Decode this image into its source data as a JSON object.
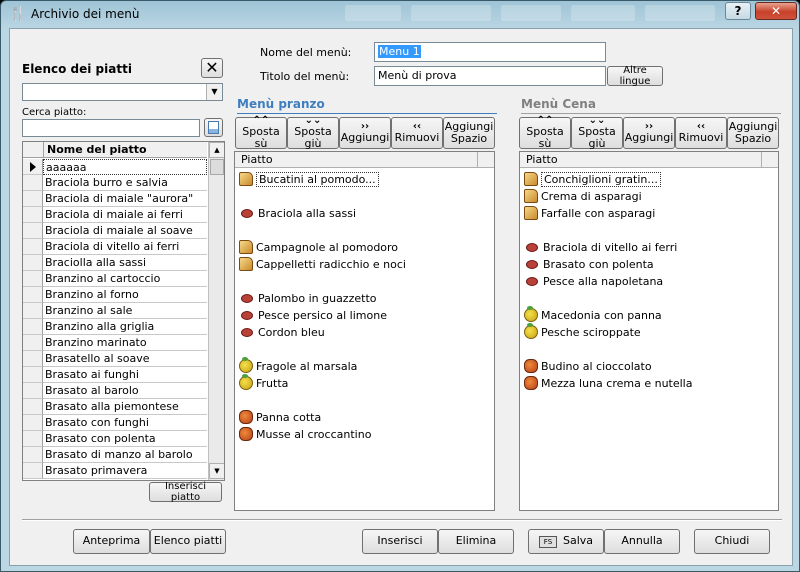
{
  "window": {
    "title": "Archivio dei menù",
    "help_label": "?",
    "close_label": "✕"
  },
  "left": {
    "list_title": "Elenco dei piatti",
    "search_label": "Cerca piatto:",
    "column_header": "Nome del piatto",
    "rows": [
      "aaaaaa",
      "Braciola burro e salvia",
      "Braciola di maiale \"aurora\"",
      "Braciola di maiale ai ferri",
      "Braciola di maiale al soave",
      "Braciola di vitello ai ferri",
      "Braciolla alla sassi",
      "Branzino al cartoccio",
      "Branzino al forno",
      "Branzino al sale",
      "Branzino alla griglia",
      "Branzino marinato",
      "Brasatello al soave",
      "Brasato ai funghi",
      "Brasato al barolo",
      "Brasato alla piemontese",
      "Brasato con funghi",
      "Brasato con polenta",
      "Brasato di manzo al barolo",
      "Brasato primavera"
    ],
    "insert_button": "Inserisci piatto"
  },
  "form": {
    "name_label": "Nome del menù:",
    "name_value": "Menu 1",
    "title_label": "Titolo del menù:",
    "title_value": "Menù di prova",
    "other_languages": "Altre lingue"
  },
  "toolbar": {
    "up": "Sposta sù",
    "down": "Sposta giù",
    "add": "Aggiungi",
    "remove": "Rimuovi",
    "add_space": "Aggiungi Spazio"
  },
  "lunch": {
    "title": "Menù pranzo",
    "column_header": "Piatto",
    "items": [
      {
        "label": "Bucatini al pomodo...",
        "icon": "bread-icon"
      },
      {
        "label": "Braciola alla sassi",
        "icon": "steak-icon"
      },
      {
        "label": "Campagnole al pomodoro",
        "icon": "bread-icon"
      },
      {
        "label": "Cappelletti radicchio e noci",
        "icon": "bread-icon"
      },
      {
        "label": "Palombo in guazzetto",
        "icon": "steak-icon"
      },
      {
        "label": "Pesce persico al limone",
        "icon": "steak-icon"
      },
      {
        "label": "Cordon bleu",
        "icon": "steak-icon"
      },
      {
        "label": "Fragole al marsala",
        "icon": "fruit-icon"
      },
      {
        "label": "Frutta",
        "icon": "fruit-icon"
      },
      {
        "label": "Panna cotta",
        "icon": "dessert-icon"
      },
      {
        "label": "Musse al croccantino",
        "icon": "dessert-icon"
      }
    ]
  },
  "dinner": {
    "title": "Menù Cena",
    "column_header": "Piatto",
    "items": [
      {
        "label": "Conchiglioni gratin...",
        "icon": "bread-icon"
      },
      {
        "label": "Crema di asparagi",
        "icon": "bread-icon"
      },
      {
        "label": "Farfalle con asparagi",
        "icon": "bread-icon"
      },
      {
        "label": "Braciola di vitello ai ferri",
        "icon": "steak-icon"
      },
      {
        "label": "Brasato con polenta",
        "icon": "steak-icon"
      },
      {
        "label": "Pesce alla napoletana",
        "icon": "steak-icon"
      },
      {
        "label": "Macedonia con panna",
        "icon": "fruit-icon"
      },
      {
        "label": "Pesche sciroppate",
        "icon": "fruit-icon"
      },
      {
        "label": "Budino al cioccolato",
        "icon": "dessert-icon"
      },
      {
        "label": "Mezza luna crema e nutella",
        "icon": "dessert-icon"
      }
    ]
  },
  "bottom": {
    "preview": "Anteprima",
    "dish_list": "Elenco piatti",
    "insert": "Inserisci",
    "delete": "Elimina",
    "save": "Salva",
    "save_icon_text": "FS",
    "cancel": "Annulla",
    "close": "Chiudi"
  },
  "colors": {
    "section_active": "#3f7fbf",
    "section_inactive": "#808080",
    "selection": "#3399ff"
  }
}
